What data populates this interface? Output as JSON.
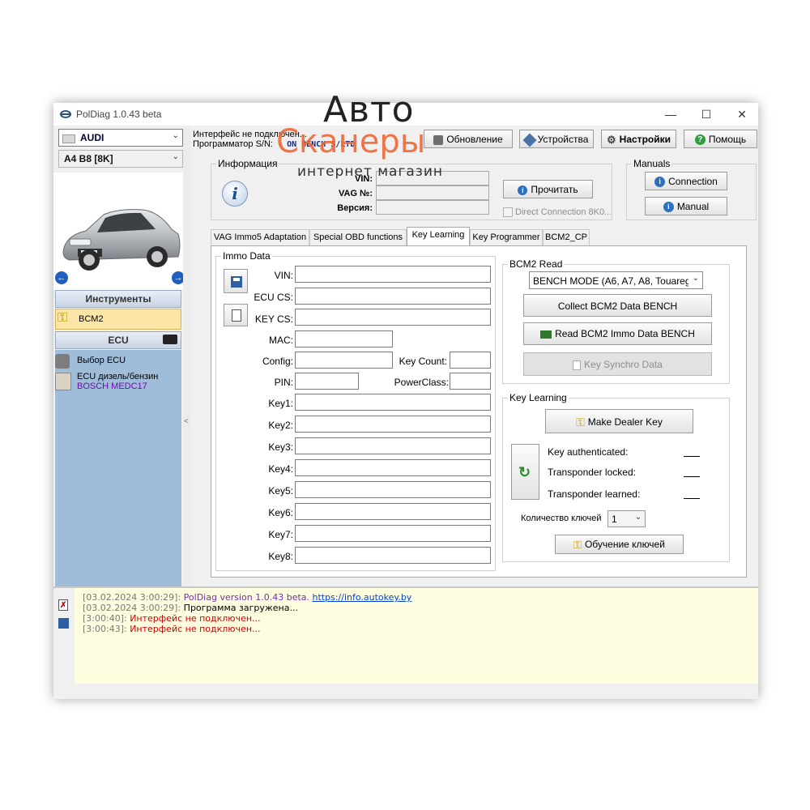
{
  "window": {
    "title": "PolDiag 1.0.43 beta",
    "minimize": "—",
    "maximize": "☐",
    "close": "✕"
  },
  "left": {
    "brand": "AUDI",
    "model": "A4 B8 [8K]",
    "tools_header": "Инструменты",
    "bcm2_item": "BCM2",
    "ecu_header": "ECU",
    "ecu_select": "Выбор ECU",
    "ecu_type": "ECU дизель/бензин",
    "ecu_model": "BOSCH MEDC17"
  },
  "status": {
    "interface": "Интерфейс не подключен...",
    "programmer_label": "Программатор S/N:",
    "programmer_value": "ON BENCH S/LTD"
  },
  "toolbar": {
    "update": "Обновление",
    "devices": "Устройства",
    "settings": "Настройки",
    "help": "Помощь"
  },
  "info": {
    "legend": "Информация",
    "vin_label": "VIN:",
    "vag_label": "VAG №:",
    "version_label": "Версия:",
    "read_button": "Прочитать",
    "direct_connection": "Direct Connection 8K0..."
  },
  "manuals": {
    "legend": "Manuals",
    "connection": "Connection",
    "manual": "Manual"
  },
  "tabs": [
    "VAG Immo5 Adaptation",
    "Special OBD functions",
    "Key Learning",
    "Key Programmer",
    "BCM2_CP"
  ],
  "active_tab": "Key Learning",
  "immo": {
    "legend": "Immo Data",
    "vin": "VIN:",
    "ecu_cs": "ECU CS:",
    "key_cs": "KEY CS:",
    "mac": "MAC:",
    "config": "Config:",
    "key_count": "Key Count:",
    "pin": "PIN:",
    "power_class": "PowerClass:",
    "keys": [
      "Key1:",
      "Key2:",
      "Key3:",
      "Key4:",
      "Key5:",
      "Key6:",
      "Key7:",
      "Key8:"
    ]
  },
  "bcm2_read": {
    "legend": "BCM2 Read",
    "mode": "BENCH MODE (A6, A7, A8, Touareg",
    "collect": "Collect BCM2 Data BENCH",
    "read": "Read BCM2 Immo Data BENCH",
    "synchro": "Key Synchro Data"
  },
  "key_learning": {
    "legend": "Key Learning",
    "make_dealer_key": "Make Dealer Key",
    "authenticated": "Key authenticated:",
    "locked": "Transponder locked:",
    "learned": "Transponder learned:",
    "count_label": "Количество ключей",
    "count_value": "1",
    "learn_button": "Обучение ключей"
  },
  "log": [
    {
      "time": "[03.02.2024 3:00:29]:",
      "msg": "PolDiag version 1.0.43 beta.",
      "link": "https://info.autokey.by",
      "color": "#7030a0"
    },
    {
      "time": "[03.02.2024 3:00:29]:",
      "msg": "Программа загружена...",
      "link": "",
      "color": "#000000"
    },
    {
      "time": "[3:00:40]:",
      "msg": "Интерфейс не подключен...",
      "link": "",
      "color": "#cc0000"
    },
    {
      "time": "[3:00:43]:",
      "msg": "Интерфейс не подключен...",
      "link": "",
      "color": "#cc0000"
    }
  ],
  "watermark": {
    "line1": "Авто",
    "line2": "Сканеры",
    "line3": "интернет магазин"
  },
  "colors": {
    "accent_blue": "#1f5fbf",
    "log_bg": "#fffde0",
    "sidebar_blue": "#9fbcd9",
    "watermark_orange": "#ef6a3a"
  }
}
